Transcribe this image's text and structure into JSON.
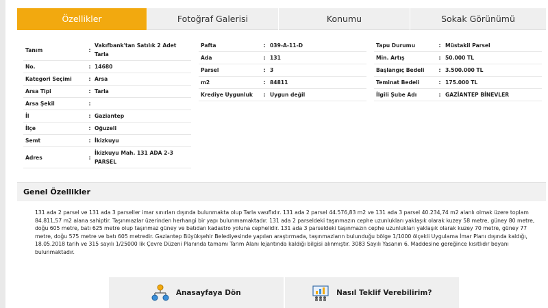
{
  "tabs": [
    {
      "label": "Özellikler"
    },
    {
      "label": "Fotoğraf Galerisi"
    },
    {
      "label": "Konumu"
    },
    {
      "label": "Sokak Görünümü"
    }
  ],
  "colors": {
    "accent": "#f2a90f"
  },
  "details_col1": [
    {
      "key": "Tanım",
      "value": "Vakıfbank'tan Satılık 2 Adet Tarla"
    },
    {
      "key": "No.",
      "value": "14680"
    },
    {
      "key": "Kategori Seçimi",
      "value": "Arsa"
    },
    {
      "key": "Arsa Tipi",
      "value": "Tarla"
    },
    {
      "key": "Arsa Şekil",
      "value": ""
    },
    {
      "key": "İl",
      "value": "Gaziantep"
    },
    {
      "key": "İlçe",
      "value": "Oğuzeli"
    },
    {
      "key": "Semt",
      "value": "İkizkuyu"
    },
    {
      "key": "Adres",
      "value": "İkizkuyu Mah. 131 ADA 2-3 PARSEL"
    }
  ],
  "details_col2": [
    {
      "key": "Pafta",
      "value": "039-A-11-D"
    },
    {
      "key": "Ada",
      "value": "131"
    },
    {
      "key": "Parsel",
      "value": "3"
    },
    {
      "key": "m2",
      "value": "84811"
    },
    {
      "key": "Krediye Uygunluk",
      "value": "Uygun değil"
    }
  ],
  "details_col3": [
    {
      "key": "Tapu Durumu",
      "value": "Müstakil Parsel"
    },
    {
      "key": "Min. Artış",
      "value": "50.000 TL"
    },
    {
      "key": "Başlangıç Bedeli",
      "value": "3.500.000 TL"
    },
    {
      "key": "Teminat Bedeli",
      "value": "175.000 TL"
    },
    {
      "key": "İlgili Şube Adı",
      "value": "GAZİANTEP BİNEVLER"
    }
  ],
  "separator": ":",
  "general": {
    "title": "Genel Özellikler",
    "text": "131 ada 2 parsel ve 131 ada 3 parseller imar sınırları dışında bulunmakta olup Tarla vasıflıdır. 131 ada 2 parsel 44.576,83 m2 ve 131 ada 3 parsel 40.234,74 m2 alanlı olmak üzere toplam 84.811,57 m2 alana sahiptir. Taşınmazlar üzerinden herhangi bir yapı bulunmamaktadır. 131 ada 2 parseldeki taşınmazın cephe uzunlukları yaklaşık olarak kuzey 58 metre, güney 80 metre, doğu 605 metre, batı 625 metre olup taşınmaz güney ve batıdan kadastro yoluna cephelidir. 131 ada 3 parseldeki taşınmazın cephe uzunlukları yaklaşık olarak kuzey 70 metre, güney 77 metre, doğu 575 metre ve batı 605 metredir. Gaziantep Büyükşehir Belediyesinde yapılan araştırmada, taşınmazların bulunduğu bölge 1/1000 ölçekli Uygulama İmar Planı dışında kaldığı, 18.05.2018 tarih ve 315 sayılı 1/25000 lik Çevre Düzeni Planında tamamı Tarım Alanı lejantında kaldığı bilgisi alınmıştır. 3083 Sayılı Yasanın 6. Maddesine gereğince kısıtlıdır beyanı bulunmaktadır."
  },
  "buttons": {
    "home_label": "Anasayfaya Dön",
    "home_icon": "sitemap-icon",
    "offer_label": "Nasıl Teklif Verebilirim?",
    "offer_icon": "presentation-icon"
  }
}
